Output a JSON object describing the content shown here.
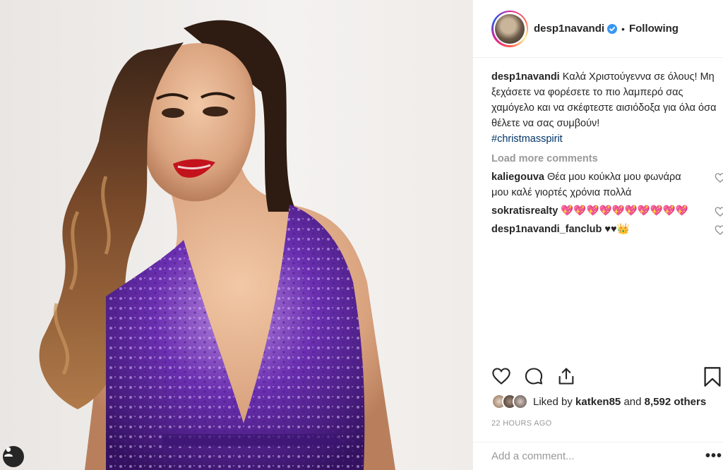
{
  "post": {
    "author": {
      "username": "desp1navandi",
      "verified": true,
      "follow_status": "Following",
      "separator": "•"
    },
    "caption": {
      "username": "desp1navandi",
      "text": "Καλά Χριστούγεννα σε όλους! Μη ξεχάσετε να φορέσετε το πιο λαμπερό σας χαμόγελο και να σκέφτεστε αισιόδοξα για όλα όσα θέλετε να σας συμβούν!",
      "hashtag": "#christmasspirit"
    },
    "load_more_label": "Load more comments",
    "comments": [
      {
        "username": "kaliegouva",
        "text": "Θέα μου κούκλα μου φωνάρα μου καλέ γιορτές χρόνια πολλά"
      },
      {
        "username": "sokratisrealty",
        "text": "💖💖💖💖💖💖💖💖💖💖"
      },
      {
        "username": "desp1navandi_fanclub",
        "text": "♥♥👑"
      }
    ],
    "likes": {
      "prefix": "Liked by",
      "liked_by_user": "katken85",
      "conjunction": "and",
      "others": "8,592 others"
    },
    "timestamp": "22 HOURS AGO",
    "add_comment_placeholder": "Add a comment...",
    "more_options": "•••"
  },
  "icons": {
    "like": "heart-icon",
    "comment": "comment-icon",
    "share": "share-icon",
    "save": "bookmark-icon",
    "verified": "verified-badge-icon",
    "user_tag": "user-tag-icon"
  },
  "colors": {
    "verified_blue": "#3897f0",
    "hashtag": "#003569",
    "muted": "#999999",
    "text": "#262626"
  }
}
